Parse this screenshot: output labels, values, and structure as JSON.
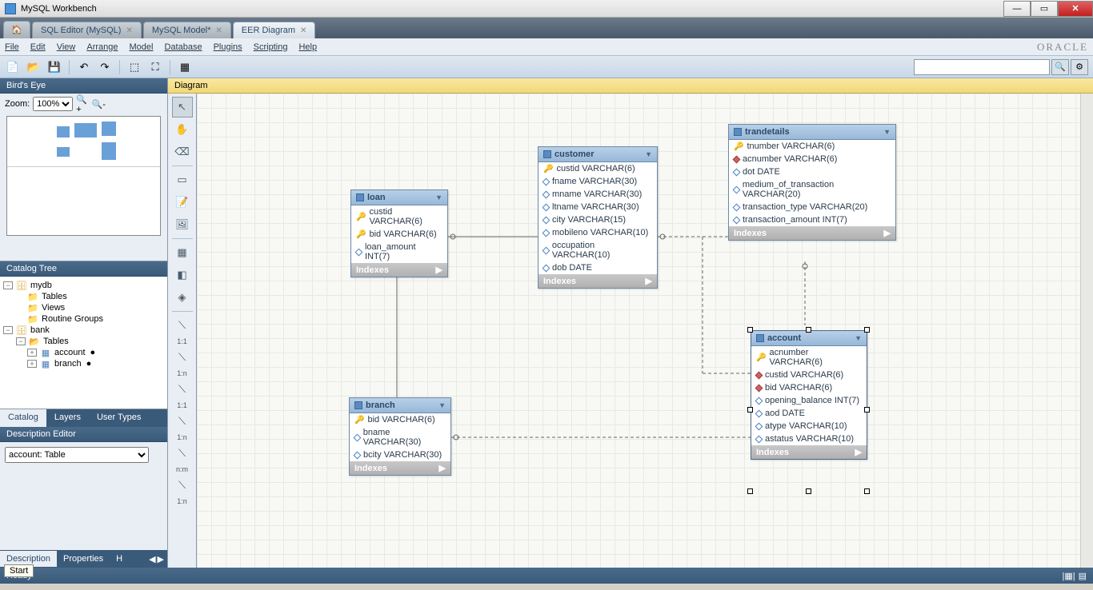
{
  "title": "MySQL Workbench",
  "window_controls": {
    "min": "—",
    "max": "▭",
    "close": "✕"
  },
  "doc_tabs": [
    {
      "label": "",
      "home": true
    },
    {
      "label": "SQL Editor (MySQL)",
      "active": false
    },
    {
      "label": "MySQL Model*",
      "active": false
    },
    {
      "label": "EER Diagram",
      "active": true
    }
  ],
  "menu": [
    "File",
    "Edit",
    "View",
    "Arrange",
    "Model",
    "Database",
    "Plugins",
    "Scripting",
    "Help"
  ],
  "oracle": "ORACLE",
  "toolbar_icons": [
    "📄",
    "📂",
    "💾",
    "↶",
    "↷",
    "⬚",
    "⛶",
    "▦"
  ],
  "search_placeholder": "",
  "sidebar": {
    "birds_eye": "Bird's Eye",
    "zoom_label": "Zoom:",
    "zoom_value": "100%",
    "catalog_tree": "Catalog Tree",
    "tree": {
      "mydb": "mydb",
      "tables": "Tables",
      "views": "Views",
      "routine": "Routine Groups",
      "bank": "bank",
      "account": "account",
      "branch": "branch"
    },
    "tabs": [
      "Catalog",
      "Layers",
      "User Types"
    ],
    "desc_header": "Description Editor",
    "desc_value": "account: Table",
    "bottom_tabs": [
      "Description",
      "Properties",
      "H"
    ]
  },
  "diagram_header": "Diagram",
  "palette_labels": {
    "r11a": "1:1",
    "r11b": "1:1",
    "r1na": "1:n",
    "rnm": "n:m",
    "r1nb": "1:n"
  },
  "tables": {
    "loan": {
      "name": "loan",
      "cols": [
        {
          "k": "pk",
          "t": "custid VARCHAR(6)"
        },
        {
          "k": "pk",
          "t": "bid VARCHAR(6)"
        },
        {
          "k": "d",
          "t": "loan_amount INT(7)"
        }
      ],
      "footer": "Indexes"
    },
    "branch": {
      "name": "branch",
      "cols": [
        {
          "k": "pk",
          "t": "bid VARCHAR(6)"
        },
        {
          "k": "d",
          "t": "bname VARCHAR(30)"
        },
        {
          "k": "d",
          "t": "bcity VARCHAR(30)"
        }
      ],
      "footer": "Indexes"
    },
    "customer": {
      "name": "customer",
      "cols": [
        {
          "k": "pk",
          "t": "custid VARCHAR(6)"
        },
        {
          "k": "d",
          "t": "fname VARCHAR(30)"
        },
        {
          "k": "d",
          "t": "mname VARCHAR(30)"
        },
        {
          "k": "d",
          "t": "ltname VARCHAR(30)"
        },
        {
          "k": "d",
          "t": "city VARCHAR(15)"
        },
        {
          "k": "d",
          "t": "mobileno VARCHAR(10)"
        },
        {
          "k": "d",
          "t": "occupation VARCHAR(10)"
        },
        {
          "k": "d",
          "t": "dob DATE"
        }
      ],
      "footer": "Indexes"
    },
    "trandetails": {
      "name": "trandetails",
      "cols": [
        {
          "k": "pk",
          "t": "tnumber VARCHAR(6)"
        },
        {
          "k": "fk",
          "t": "acnumber VARCHAR(6)"
        },
        {
          "k": "d",
          "t": "dot DATE"
        },
        {
          "k": "d",
          "t": "medium_of_transaction VARCHAR(20)"
        },
        {
          "k": "d",
          "t": "transaction_type VARCHAR(20)"
        },
        {
          "k": "d",
          "t": "transaction_amount INT(7)"
        }
      ],
      "footer": "Indexes"
    },
    "account": {
      "name": "account",
      "cols": [
        {
          "k": "pk",
          "t": "acnumber VARCHAR(6)"
        },
        {
          "k": "fk",
          "t": "custid VARCHAR(6)"
        },
        {
          "k": "fk",
          "t": "bid VARCHAR(6)"
        },
        {
          "k": "d",
          "t": "opening_balance INT(7)"
        },
        {
          "k": "d",
          "t": "aod DATE"
        },
        {
          "k": "d",
          "t": "atype VARCHAR(10)"
        },
        {
          "k": "d",
          "t": "astatus VARCHAR(10)"
        }
      ],
      "footer": "Indexes"
    }
  },
  "status": {
    "ready": "Ready"
  },
  "start_tip": "Start"
}
